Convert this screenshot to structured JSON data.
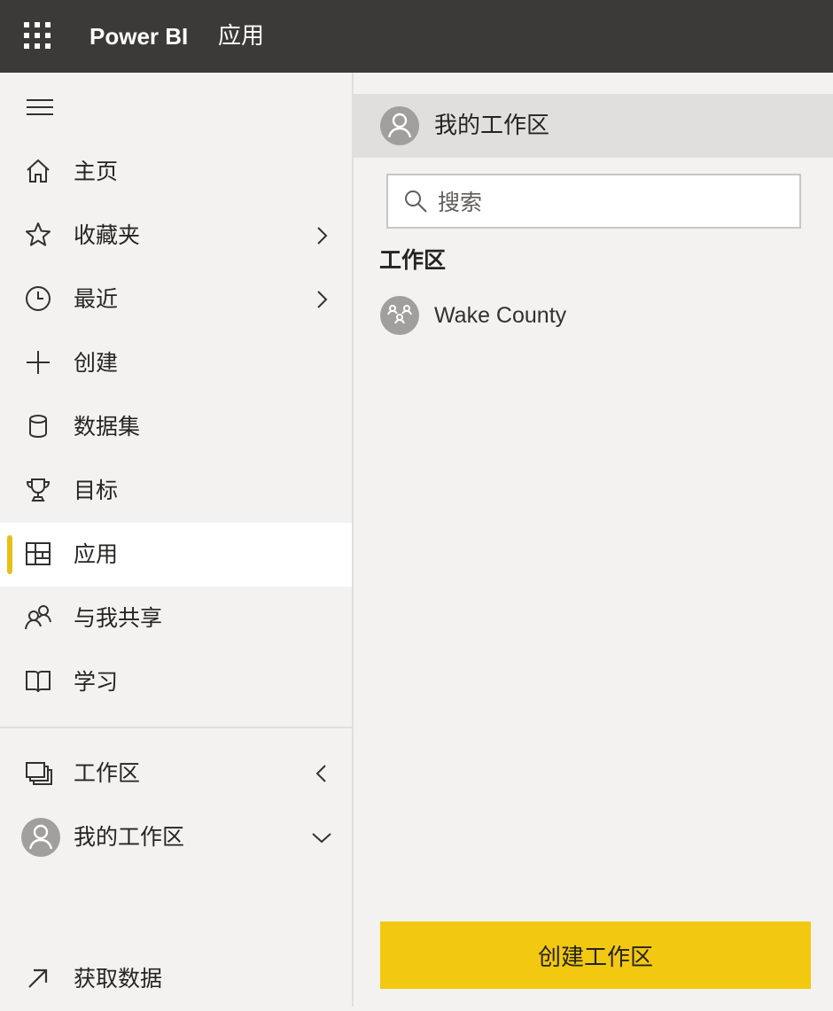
{
  "topbar": {
    "waffle_icon": "waffle-icon",
    "brand": "Power BI",
    "breadcrumb": "应用"
  },
  "nav": {
    "items": [
      {
        "label": "主页",
        "icon": "home-icon"
      },
      {
        "label": "收藏夹",
        "icon": "star-icon",
        "chevron": "right"
      },
      {
        "label": "最近",
        "icon": "clock-icon",
        "chevron": "right"
      },
      {
        "label": "创建",
        "icon": "plus-icon"
      },
      {
        "label": "数据集",
        "icon": "database-icon"
      },
      {
        "label": "目标",
        "icon": "trophy-icon"
      },
      {
        "label": "应用",
        "icon": "apps-icon",
        "active": true
      },
      {
        "label": "与我共享",
        "icon": "shared-icon"
      },
      {
        "label": "学习",
        "icon": "book-icon"
      }
    ],
    "workspaces": {
      "label": "工作区",
      "icon": "workspaces-icon",
      "chevron": "left"
    },
    "my_workspace": {
      "label": "我的工作区",
      "icon": "avatar-icon",
      "chevron": "down"
    },
    "get_data": {
      "label": "获取数据",
      "icon": "arrow-up-right-icon"
    }
  },
  "flyout": {
    "header_title": "我的工作区",
    "search_placeholder": "搜索",
    "section_label": "工作区",
    "workspaces": [
      {
        "name": "Wake County",
        "icon": "workspace-group-icon"
      }
    ],
    "create_button": "创建工作区"
  },
  "colors": {
    "topbar_bg": "#3b3a39",
    "accent_yellow": "#f2c811",
    "active_indicator": "#e8c116",
    "panel_bg": "#f3f2f1",
    "header_bg": "#e1dfdd"
  }
}
